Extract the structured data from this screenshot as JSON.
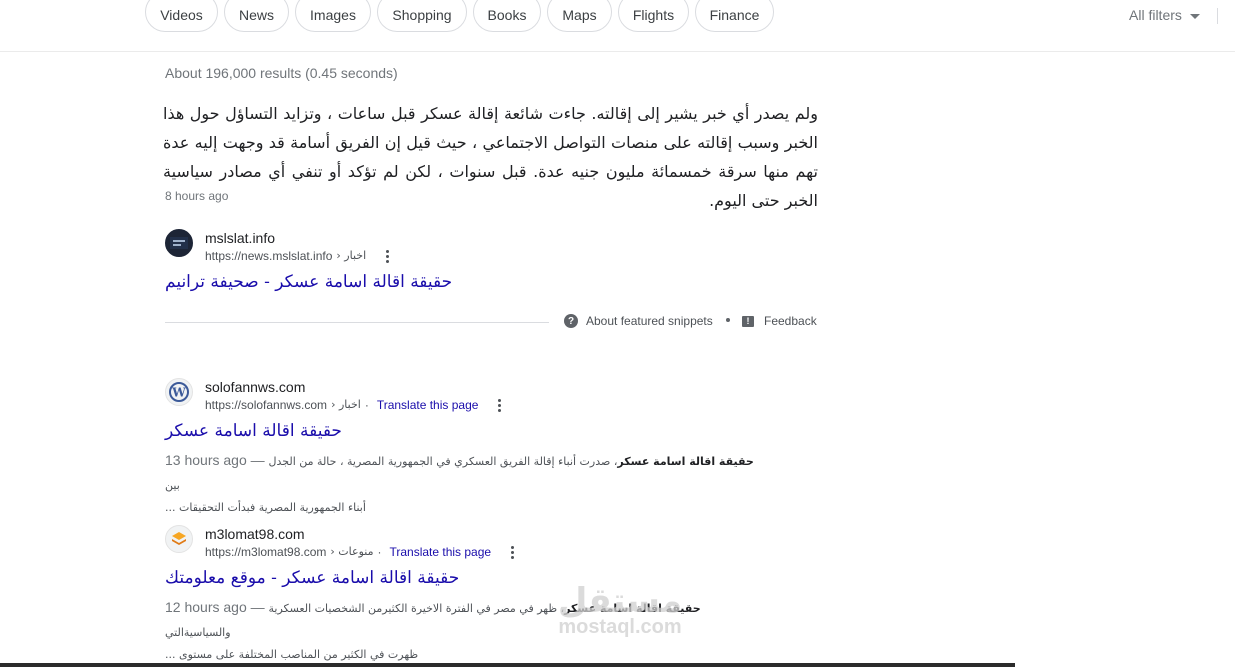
{
  "filters": {
    "chips": [
      "Videos",
      "News",
      "Images",
      "Shopping",
      "Books",
      "Maps",
      "Flights",
      "Finance"
    ],
    "all_filters_label": "All filters"
  },
  "stats": "About 196,000 results (0.45 seconds)",
  "featured_snippet": {
    "text": "ولم يصدر أي خبر يشير إلى إقالته. جاءت شائعة إقالة عسكر قبل ساعات ، وتزايد التساؤل حول هذا الخبر وسبب إقالته على منصات التواصل الاجتماعي ، حيث قيل إن الفريق أسامة قد وجهت إليه عدة تهم منها سرقة خمسمائة مليون جنيه عدة. قبل سنوات ، لكن لم تؤكد أو تنفي أي مصادر سياسية الخبر حتى اليوم.",
    "date": "8 hours ago",
    "source": {
      "site_name": "mslslat.info",
      "url": "https://news.mslslat.info",
      "breadcrumb": "› اخبار",
      "title": "حقيقة اقالة اسامة عسكر - صحيفة ترانيم"
    },
    "about_label": "About featured snippets",
    "feedback_label": "Feedback"
  },
  "results": [
    {
      "site_name": "solofannws.com",
      "url": "https://solofannws.com",
      "breadcrumb": "› اخبار",
      "translate_label": "Translate this page",
      "title": "حقيقة اقالة اسامة عسكر",
      "age": "13 hours ago",
      "separator": "—",
      "desc_bold": "حقيقة اقالة اسامة عسكر",
      "desc_line1": "، صدرت أنباء إقالة الفريق العسكري في الجمهورية المصرية ، حالة من الجدل بين",
      "desc_line2": "أبناء الجمهورية المصرية فبدأت التحقيقات ..."
    },
    {
      "site_name": "m3lomat98.com",
      "url": "https://m3lomat98.com",
      "breadcrumb": "› منوعات",
      "translate_label": "Translate this page",
      "title": "حقيقة اقالة اسامة عسكر - موقع معلومتك",
      "age": "12 hours ago",
      "separator": "—",
      "desc_bold": "حقيقة اقالة اسامة عسكر",
      "desc_line1": "، ظهر في مصر في الفترة الاخيرة الكثيرمن الشخصيات العسكرية والسياسيةالتي",
      "desc_line2": "ظهرت في الكثير من المناصب المختلفة على مستوى ..."
    }
  ],
  "watermark": {
    "arabic": "مستقل",
    "latin": "mostaql.com"
  }
}
